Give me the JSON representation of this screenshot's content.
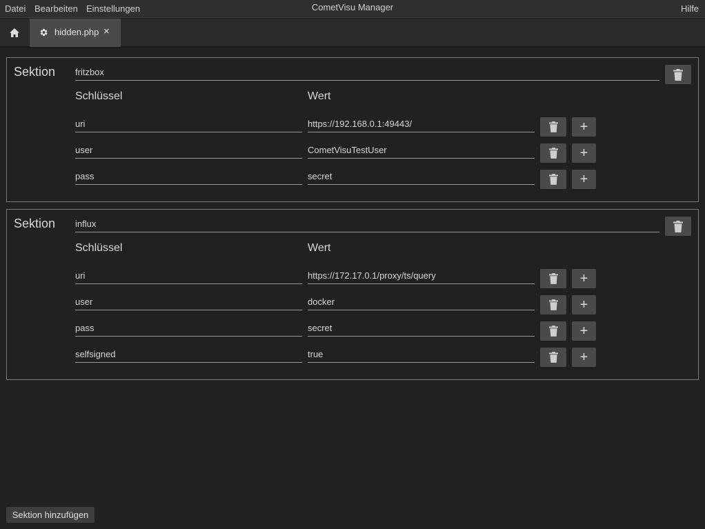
{
  "menubar": {
    "items": [
      "Datei",
      "Bearbeiten",
      "Einstellungen"
    ],
    "title": "CometVisu Manager",
    "help": "Hilfe"
  },
  "tabs": {
    "home_icon": "home-icon",
    "file_icon": "gear-icon",
    "file_label": "hidden.php",
    "close_icon": "close-icon",
    "close_glyph": "×"
  },
  "labels": {
    "section": "Sektion",
    "key_header": "Schlüssel",
    "value_header": "Wert",
    "add_section": "Sektion hinzufügen"
  },
  "sections": [
    {
      "name": "fritzbox",
      "entries": [
        {
          "key": "uri",
          "value": "https://192.168.0.1:49443/"
        },
        {
          "key": "user",
          "value": "CometVisuTestUser"
        },
        {
          "key": "pass",
          "value": "secret"
        }
      ]
    },
    {
      "name": "influx",
      "entries": [
        {
          "key": "uri",
          "value": "https://172.17.0.1/proxy/ts/query"
        },
        {
          "key": "user",
          "value": "docker"
        },
        {
          "key": "pass",
          "value": "secret"
        },
        {
          "key": "selfsigned",
          "value": "true"
        }
      ]
    }
  ],
  "icons": {
    "delete": "trash-icon",
    "add": "plus-icon",
    "add_glyph": "+"
  },
  "colors": {
    "background": "#212121",
    "menubar": "#303030",
    "active_tab": "#4a4a4a",
    "button": "#4a4a4a",
    "section_border": "#7a7a7a"
  }
}
